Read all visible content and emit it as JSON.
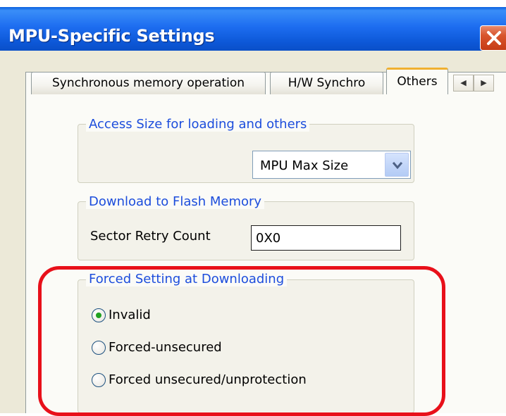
{
  "window": {
    "title": "MPU-Specific Settings"
  },
  "tabs": [
    {
      "label": "Synchronous memory operation",
      "active": false
    },
    {
      "label": "H/W Synchro",
      "active": false
    },
    {
      "label": "Others",
      "active": true
    }
  ],
  "tab_scroll": {
    "left": "◀",
    "right": "▶"
  },
  "access_size": {
    "legend": "Access Size for loading and others",
    "selected": "MPU Max Size"
  },
  "flash": {
    "legend": "Download to Flash Memory",
    "sector_retry_label": "Sector Retry Count",
    "sector_retry_value": "0X0"
  },
  "forced": {
    "legend": "Forced Setting at Downloading",
    "options": [
      {
        "label": "Invalid",
        "checked": true
      },
      {
        "label": "Forced-unsecured",
        "checked": false
      },
      {
        "label": "Forced unsecured/unprotection",
        "checked": false
      }
    ]
  },
  "colors": {
    "titlebar": "#1d6df0",
    "legend": "#1c4ddc",
    "highlight": "#e8101a",
    "tab_active": "#f0b030"
  }
}
